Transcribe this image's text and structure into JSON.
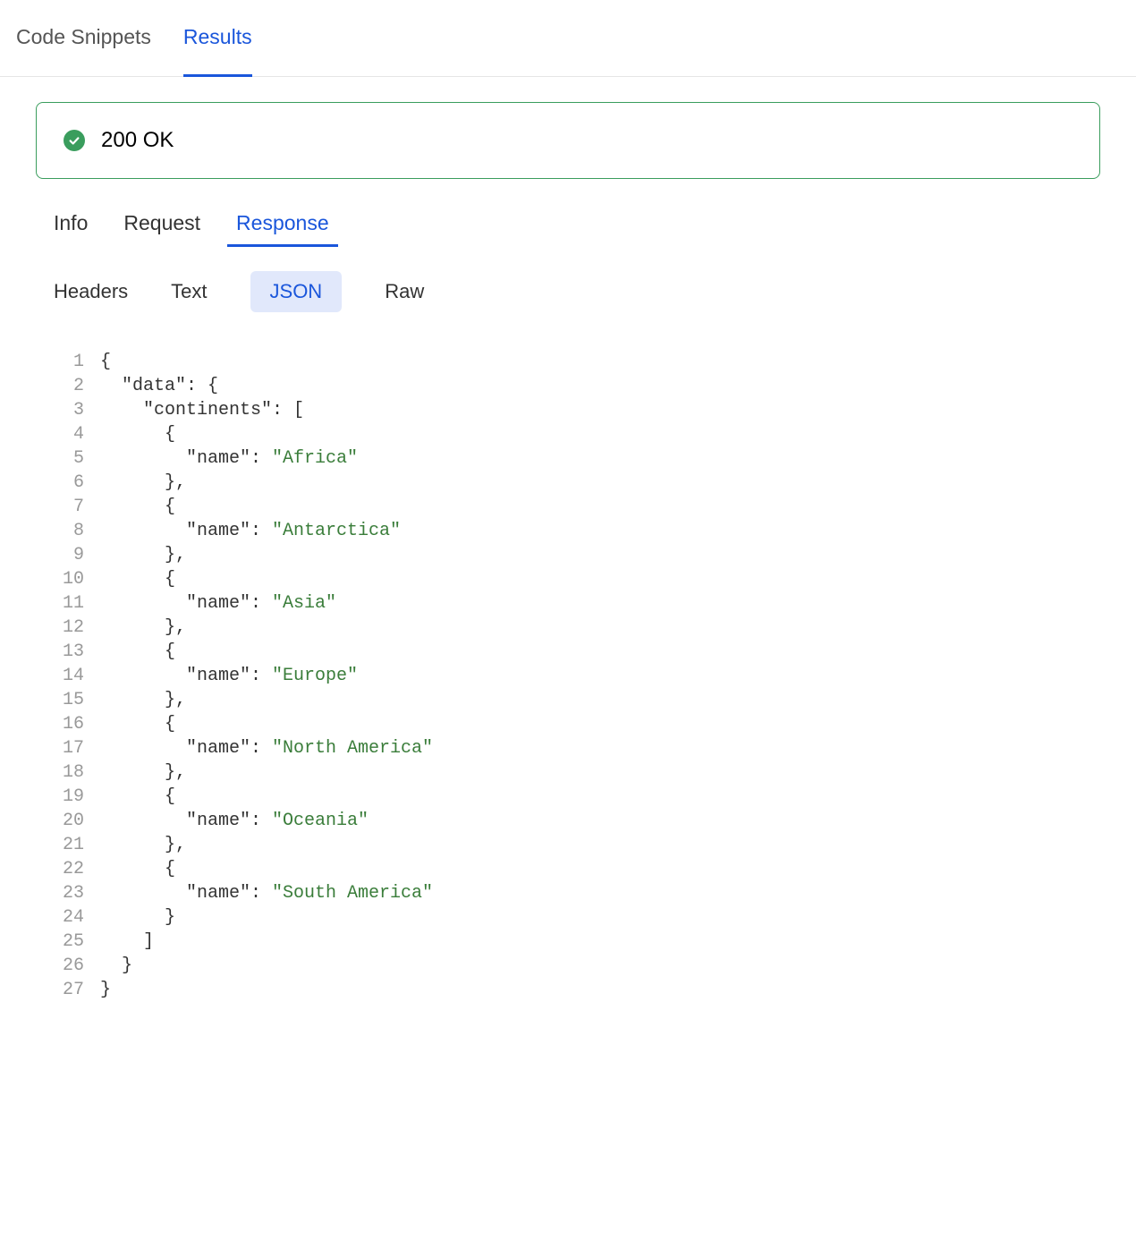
{
  "topTabs": [
    {
      "label": "Code Snippets",
      "active": false
    },
    {
      "label": "Results",
      "active": true
    }
  ],
  "status": {
    "text": "200 OK"
  },
  "subTabs": [
    {
      "label": "Info",
      "active": false
    },
    {
      "label": "Request",
      "active": false
    },
    {
      "label": "Response",
      "active": true
    }
  ],
  "formatTabs": [
    {
      "label": "Headers",
      "active": false
    },
    {
      "label": "Text",
      "active": false
    },
    {
      "label": "JSON",
      "active": true
    },
    {
      "label": "Raw",
      "active": false
    }
  ],
  "jsonLines": [
    {
      "n": 1,
      "indent": "",
      "pre": "{",
      "str": null,
      "post": ""
    },
    {
      "n": 2,
      "indent": "  ",
      "pre": "\"data\": {",
      "str": null,
      "post": ""
    },
    {
      "n": 3,
      "indent": "    ",
      "pre": "\"continents\": [",
      "str": null,
      "post": ""
    },
    {
      "n": 4,
      "indent": "      ",
      "pre": "{",
      "str": null,
      "post": ""
    },
    {
      "n": 5,
      "indent": "        ",
      "pre": "\"name\": ",
      "str": "\"Africa\"",
      "post": ""
    },
    {
      "n": 6,
      "indent": "      ",
      "pre": "},",
      "str": null,
      "post": ""
    },
    {
      "n": 7,
      "indent": "      ",
      "pre": "{",
      "str": null,
      "post": ""
    },
    {
      "n": 8,
      "indent": "        ",
      "pre": "\"name\": ",
      "str": "\"Antarctica\"",
      "post": ""
    },
    {
      "n": 9,
      "indent": "      ",
      "pre": "},",
      "str": null,
      "post": ""
    },
    {
      "n": 10,
      "indent": "      ",
      "pre": "{",
      "str": null,
      "post": ""
    },
    {
      "n": 11,
      "indent": "        ",
      "pre": "\"name\": ",
      "str": "\"Asia\"",
      "post": ""
    },
    {
      "n": 12,
      "indent": "      ",
      "pre": "},",
      "str": null,
      "post": ""
    },
    {
      "n": 13,
      "indent": "      ",
      "pre": "{",
      "str": null,
      "post": ""
    },
    {
      "n": 14,
      "indent": "        ",
      "pre": "\"name\": ",
      "str": "\"Europe\"",
      "post": ""
    },
    {
      "n": 15,
      "indent": "      ",
      "pre": "},",
      "str": null,
      "post": ""
    },
    {
      "n": 16,
      "indent": "      ",
      "pre": "{",
      "str": null,
      "post": ""
    },
    {
      "n": 17,
      "indent": "        ",
      "pre": "\"name\": ",
      "str": "\"North America\"",
      "post": ""
    },
    {
      "n": 18,
      "indent": "      ",
      "pre": "},",
      "str": null,
      "post": ""
    },
    {
      "n": 19,
      "indent": "      ",
      "pre": "{",
      "str": null,
      "post": ""
    },
    {
      "n": 20,
      "indent": "        ",
      "pre": "\"name\": ",
      "str": "\"Oceania\"",
      "post": ""
    },
    {
      "n": 21,
      "indent": "      ",
      "pre": "},",
      "str": null,
      "post": ""
    },
    {
      "n": 22,
      "indent": "      ",
      "pre": "{",
      "str": null,
      "post": ""
    },
    {
      "n": 23,
      "indent": "        ",
      "pre": "\"name\": ",
      "str": "\"South America\"",
      "post": ""
    },
    {
      "n": 24,
      "indent": "      ",
      "pre": "}",
      "str": null,
      "post": ""
    },
    {
      "n": 25,
      "indent": "    ",
      "pre": "]",
      "str": null,
      "post": ""
    },
    {
      "n": 26,
      "indent": "  ",
      "pre": "}",
      "str": null,
      "post": ""
    },
    {
      "n": 27,
      "indent": "",
      "pre": "}",
      "str": null,
      "post": ""
    }
  ]
}
